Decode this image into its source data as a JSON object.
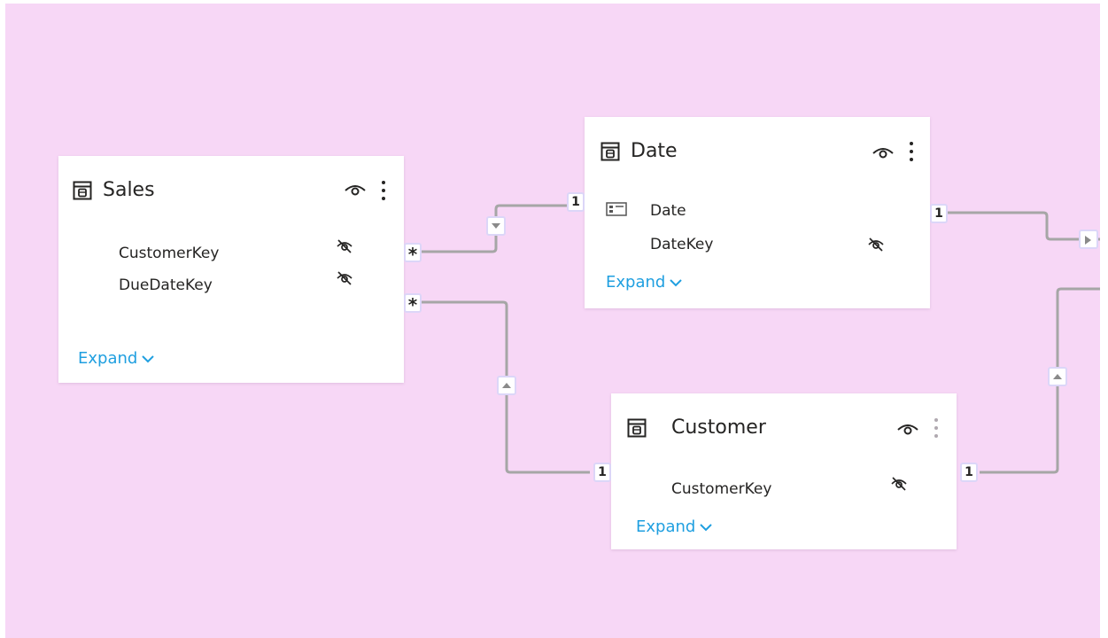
{
  "colors": {
    "canvas": "#f7d7f6",
    "accent": "#1f9fe0",
    "wire": "#a6a6a6",
    "badge_border": "#dcd6f8"
  },
  "tables": {
    "sales": {
      "title": "Sales",
      "fields": [
        {
          "name": "CustomerKey",
          "hidden": true
        },
        {
          "name": "DueDateKey",
          "hidden": true
        }
      ],
      "expand_label": "Expand"
    },
    "date": {
      "title": "Date",
      "fields": [
        {
          "name": "Date",
          "hidden": false,
          "icon": "date-hierarchy-icon"
        },
        {
          "name": "DateKey",
          "hidden": true
        }
      ],
      "expand_label": "Expand"
    },
    "customer": {
      "title": "Customer",
      "fields": [
        {
          "name": "CustomerKey",
          "hidden": true
        }
      ],
      "expand_label": "Expand"
    }
  },
  "relationships": [
    {
      "from": "Sales",
      "to": "Date",
      "from_cardinality": "*",
      "to_cardinality": "1",
      "filter_direction": "down"
    },
    {
      "from": "Sales",
      "to": "Customer",
      "from_cardinality": "*",
      "to_cardinality": "1",
      "filter_direction": "up"
    },
    {
      "from": "Date",
      "to": "offscreen-table",
      "from_cardinality": "1",
      "filter_direction": "right"
    },
    {
      "from": "Customer",
      "to": "offscreen-table",
      "from_cardinality": "1",
      "filter_direction": "up"
    }
  ]
}
